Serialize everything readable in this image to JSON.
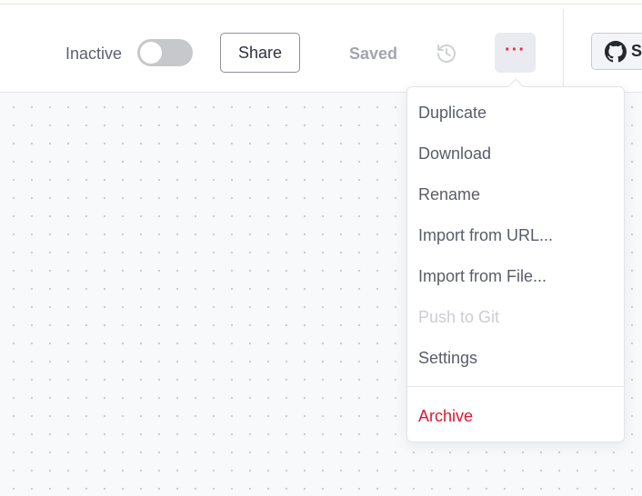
{
  "header": {
    "status_label": "Inactive",
    "toggle_on": false,
    "share_label": "Share",
    "saved_label": "Saved",
    "history_icon": "history-icon",
    "more_icon": "more-horizontal-icon",
    "github_label": "S"
  },
  "menu": {
    "items": [
      {
        "label": "Duplicate",
        "state": "enabled"
      },
      {
        "label": "Download",
        "state": "enabled"
      },
      {
        "label": "Rename",
        "state": "enabled"
      },
      {
        "label": "Import from URL...",
        "state": "enabled"
      },
      {
        "label": "Import from File...",
        "state": "enabled"
      },
      {
        "label": "Push to Git",
        "state": "disabled"
      },
      {
        "label": "Settings",
        "state": "enabled"
      },
      {
        "label": "Archive",
        "state": "danger"
      }
    ]
  },
  "colors": {
    "accent": "#ea2b41",
    "danger": "#e0162e",
    "disabled_text": "#cbcdd3",
    "menu_text": "#585d6a"
  }
}
